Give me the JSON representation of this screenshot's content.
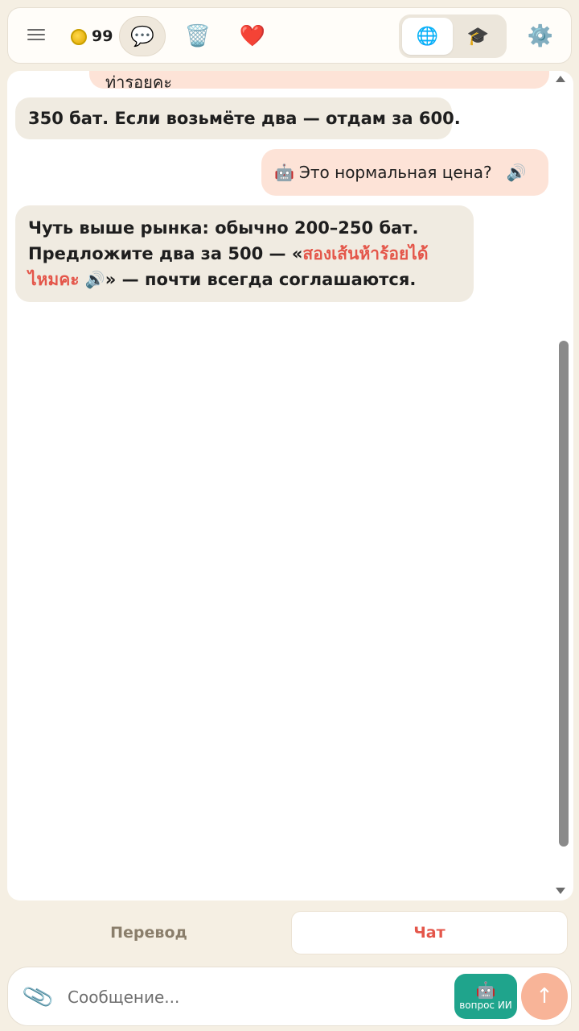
{
  "header": {
    "coins": "99",
    "icons": {
      "menu": "menu-icon",
      "chat": "💬",
      "trash": "🗑️",
      "heart": "❤️",
      "globe": "🌐",
      "grad": "🎓",
      "gear": "⚙️"
    }
  },
  "messages": {
    "top_partial": "ท่ารอยคะ",
    "m1": "350 бат. Если возьмёте два — отдам за 600.",
    "m2": {
      "robot": "🤖",
      "text": "Это нормальная цена?",
      "speaker": "🔊"
    },
    "m3": {
      "line1": "Чуть выше рынка: обычно 200–250 бат.",
      "line2_prefix": "Предложите два за 500 — «",
      "thai_part1": "สองเส้นห้าร้อยได้",
      "thai_part2": "ไหมคะ",
      "speaker": "🔊",
      "line3_suffix": "» — почти всегда соглашаются."
    }
  },
  "tabs": {
    "translate": "Перевод",
    "chat": "Чат",
    "active": "chat"
  },
  "input": {
    "placeholder": "Сообщение...",
    "ai_robot": "🤖",
    "ai_label": "вопрос ИИ",
    "send": "↑",
    "clip": "📎"
  },
  "colors": {
    "accent": "#e4564a",
    "ai_button": "#1fa48c",
    "send_button": "#f8b498",
    "my_bubble": "#fde3d7",
    "partner_bubble": "#f0ebe1"
  }
}
